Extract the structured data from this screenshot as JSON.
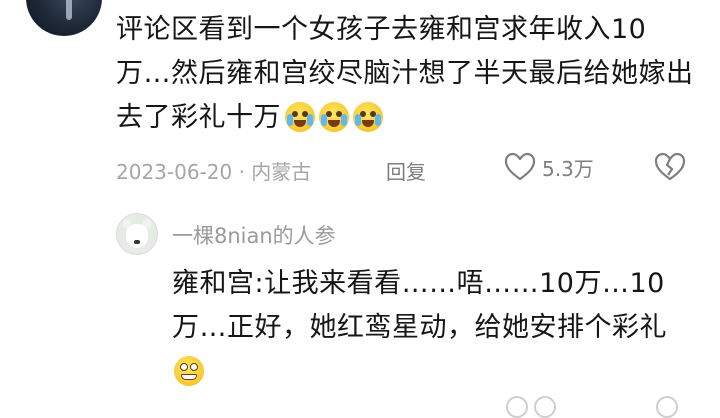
{
  "comment": {
    "text": "评论区看到一个女孩子去雍和宫求年收入10万…然后雍和宫绞尽脑汁想了半天最后给她嫁出去了彩礼十万",
    "emojis": [
      "crying-laughing-emoji",
      "crying-laughing-emoji",
      "crying-laughing-emoji"
    ],
    "date_location": "2023-06-20 · 内蒙古",
    "reply_label": "回复",
    "like_count": "5.3万"
  },
  "reply": {
    "username": "一棵8nian的人参",
    "text": "雍和宫:让我来看看……唔……10万…10万…正好，她红鸾星动，给她安排个彩礼",
    "emoji": "grinning-emoji"
  },
  "colors": {
    "text": "#161616",
    "meta": "#a6a6a6",
    "icon": "#7e7e7e",
    "username": "#9a9a9a"
  }
}
